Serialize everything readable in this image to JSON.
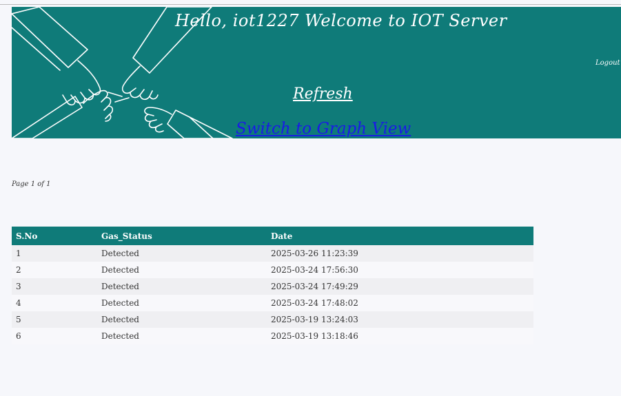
{
  "header": {
    "title": "Hello, iot1227 Welcome to IOT Server",
    "logout_label": "Logout",
    "refresh_label": "Refresh",
    "graph_view_label": "Switch to Graph View"
  },
  "pagination": {
    "indicator": "Page 1 of 1"
  },
  "table": {
    "columns": [
      "S.No",
      "Gas_Status",
      "Date"
    ],
    "rows": [
      [
        "1",
        "Detected",
        "2025-03-26 11:23:39"
      ],
      [
        "2",
        "Detected",
        "2025-03-24 17:56:30"
      ],
      [
        "3",
        "Detected",
        "2025-03-24 17:49:29"
      ],
      [
        "4",
        "Detected",
        "2025-03-24 17:48:02"
      ],
      [
        "5",
        "Detected",
        "2025-03-19 13:24:03"
      ],
      [
        "6",
        "Detected",
        "2025-03-19 13:18:46"
      ]
    ]
  },
  "colors": {
    "banner": "#0f7b79",
    "link": "#1a1ae6",
    "header_row": "#0f7b79"
  },
  "icons": {
    "banner_art": "hands-teamwork-icon"
  }
}
